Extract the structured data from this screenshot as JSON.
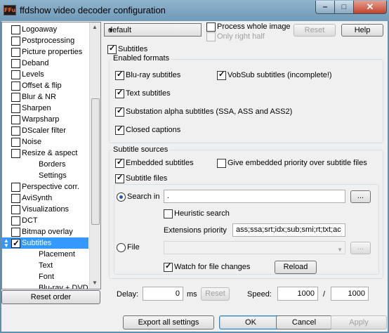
{
  "window": {
    "title": "ffdshow video decoder configuration",
    "icon_text": "FFu",
    "min_glyph": "‒",
    "max_glyph": "□",
    "close_glyph": "✕"
  },
  "sidebar": {
    "items": [
      {
        "label": "Logoaway",
        "checked": false
      },
      {
        "label": "Postprocessing",
        "checked": false
      },
      {
        "label": "Picture properties",
        "checked": false
      },
      {
        "label": "Deband",
        "checked": false
      },
      {
        "label": "Levels",
        "checked": false
      },
      {
        "label": "Offset & flip",
        "checked": false
      },
      {
        "label": "Blur & NR",
        "checked": false
      },
      {
        "label": "Sharpen",
        "checked": false
      },
      {
        "label": "Warpsharp",
        "checked": false
      },
      {
        "label": "DScaler filter",
        "checked": false
      },
      {
        "label": "Noise",
        "checked": false
      },
      {
        "label": "Resize & aspect",
        "checked": false
      },
      {
        "label": "Borders",
        "sub": true
      },
      {
        "label": "Settings",
        "sub": true
      },
      {
        "label": "Perspective corr.",
        "checked": false
      },
      {
        "label": "AviSynth",
        "checked": false
      },
      {
        "label": "Visualizations",
        "checked": false
      },
      {
        "label": "DCT",
        "checked": false
      },
      {
        "label": "Bitmap overlay",
        "checked": false
      },
      {
        "label": "Subtitles",
        "checked": true,
        "selected": true
      },
      {
        "label": "Placement",
        "sub": true
      },
      {
        "label": "Text",
        "sub": true
      },
      {
        "label": "Font",
        "sub": true
      },
      {
        "label": "Blu-ray + DVD",
        "sub": true
      }
    ],
    "reset_order": "Reset order"
  },
  "top": {
    "preset": "default",
    "process_whole_image": "Process whole image",
    "only_right_half": "Only right half",
    "reset": "Reset",
    "help": "Help"
  },
  "subtitles": {
    "enable_label": "Subtitles",
    "enabled_formats_title": "Enabled formats",
    "formats": {
      "bluray": "Blu-ray subtitles",
      "vobsub": "VobSub subtitles (incomplete!)",
      "text": "Text subtitles",
      "ssa": "Substation alpha subtitles (SSA, ASS and ASS2)",
      "cc": "Closed captions"
    },
    "sources_title": "Subtitle sources",
    "embedded": "Embedded subtitles",
    "embedded_priority": "Give embedded priority over subtitle files",
    "subtitle_files": "Subtitle files",
    "search_in": "Search in",
    "search_path": ".",
    "browse": "...",
    "heuristic": "Heuristic search",
    "ext_priority_label": "Extensions priority",
    "ext_priority_value": "ass;ssa;srt;idx;sub;smi;rt;txt;ac",
    "file_label": "File",
    "file_value": "",
    "watch_changes": "Watch for file changes",
    "reload": "Reload"
  },
  "delay": {
    "label": "Delay:",
    "value": "0",
    "unit": "ms",
    "reset": "Reset"
  },
  "speed": {
    "label": "Speed:",
    "value1": "1000",
    "sep": "/",
    "value2": "1000"
  },
  "footer": {
    "export": "Export all settings",
    "ok": "OK",
    "cancel": "Cancel",
    "apply": "Apply"
  }
}
